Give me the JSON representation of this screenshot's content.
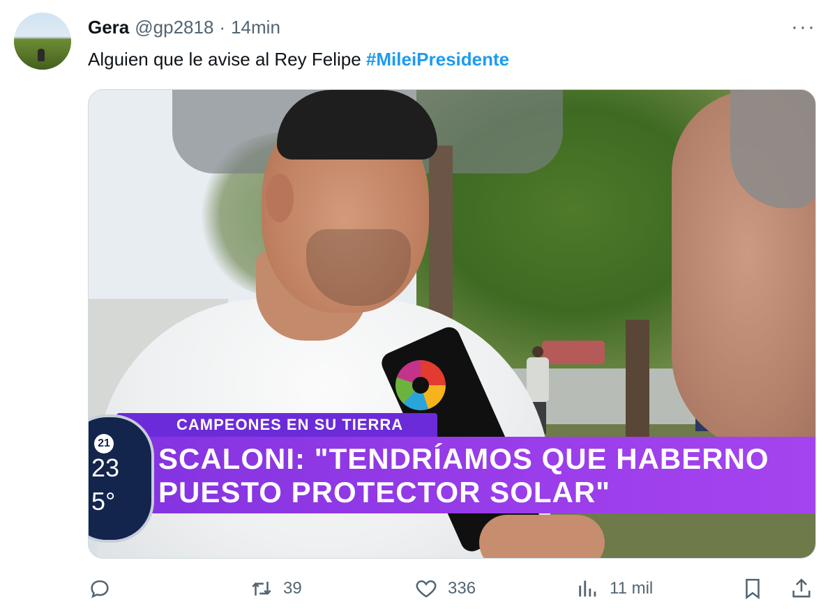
{
  "author": {
    "name": "Gera",
    "handle": "@gp2818",
    "separator": "·",
    "time": "14min"
  },
  "menu": {
    "more_label": "···"
  },
  "tweet": {
    "text": "Alguien que le avise al Rey Felipe",
    "hashtag": "#MileiPresidente"
  },
  "media": {
    "banner_top": "CAMPEONES EN SU TIERRA",
    "headline_line1": "SCALONI: \"TENDRÍAMOS QUE HABERNO",
    "headline_line2": "PUESTO PROTECTOR SOLAR\"",
    "clock_day": "21",
    "clock_time": "23",
    "clock_temp": "5°"
  },
  "actions": {
    "reply_icon": "reply-icon",
    "retweets": "39",
    "likes": "336",
    "views": "11 mil",
    "bookmark_icon": "bookmark-icon",
    "share_icon": "share-icon"
  },
  "colors": {
    "hashtag": "#1d9bf0",
    "muted_text": "#536471",
    "banner_purple": "#9a3dea"
  }
}
